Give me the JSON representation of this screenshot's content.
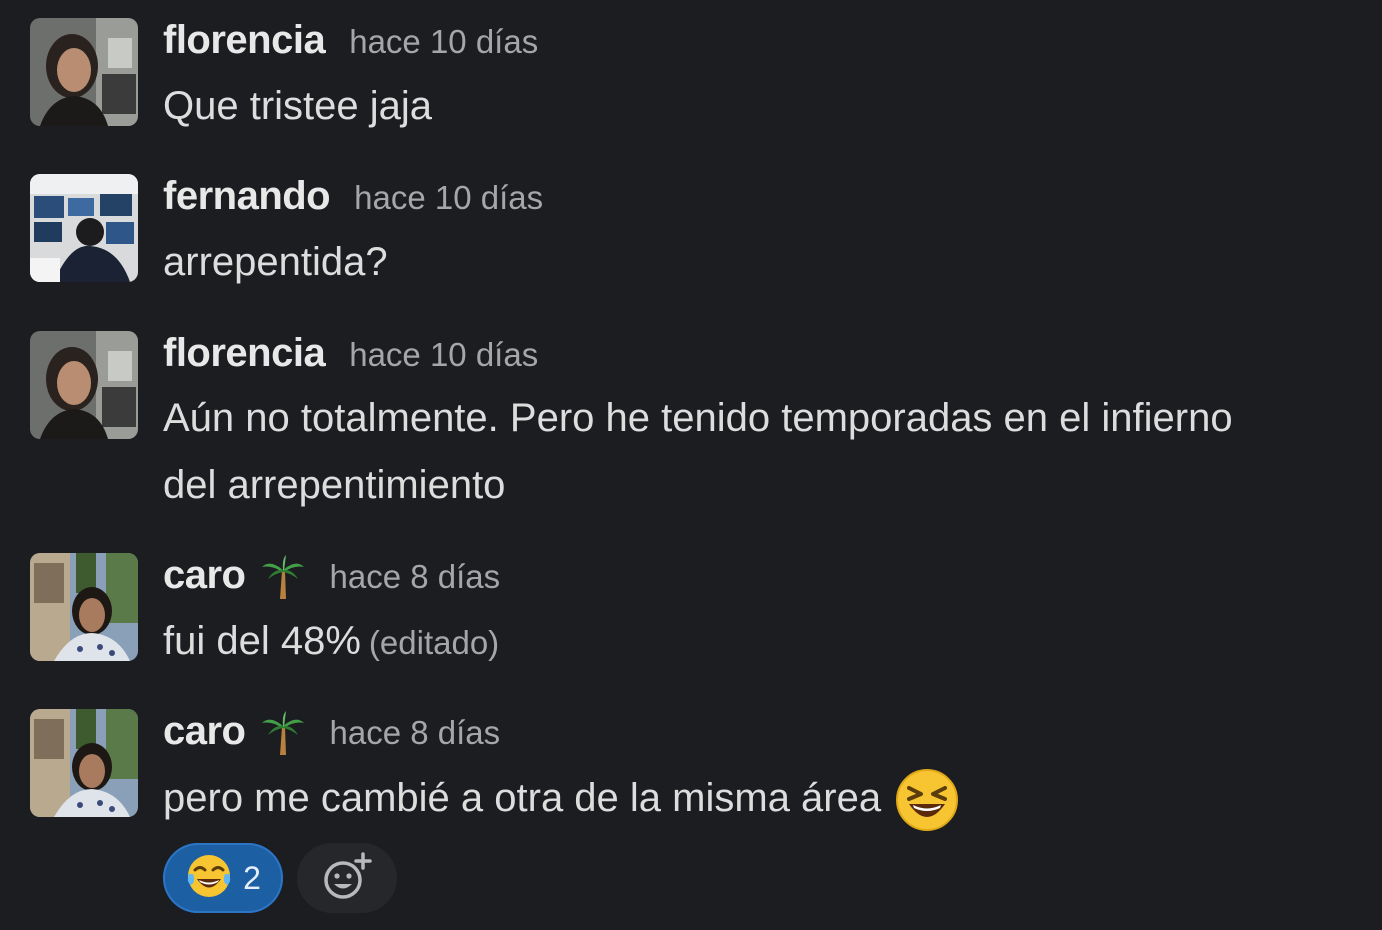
{
  "messages": [
    {
      "author": "florencia",
      "avatar": "avatar-florencia",
      "timestamp": "hace 10 días",
      "lines": [
        "Que tristee jaja"
      ]
    },
    {
      "author": "fernando",
      "avatar": "avatar-fernando",
      "timestamp": "hace 10 días",
      "lines": [
        "arrepentida?"
      ]
    },
    {
      "author": "florencia",
      "avatar": "avatar-florencia",
      "timestamp": "hace 10 días",
      "lines": [
        "Aún no totalmente. Pero he tenido temporadas en el infierno",
        "del arrepentimiento"
      ]
    },
    {
      "author": "caro",
      "avatar": "avatar-caro",
      "status_emoji": "palm-tree-icon",
      "timestamp": "hace 8 días",
      "lines": [
        "fui del 48%"
      ],
      "edited": "(editado)"
    },
    {
      "author": "caro",
      "avatar": "avatar-caro",
      "status_emoji": "palm-tree-icon",
      "timestamp": "hace 8 días",
      "lines": [
        "pero me cambié a otra de la misma área"
      ],
      "trailing_emoji": "laughing-face-icon",
      "reactions": [
        {
          "emoji": "tears-of-joy-icon",
          "count": "2",
          "selected": true
        }
      ],
      "add_reaction_icon": "add-reaction-icon"
    }
  ],
  "colors": {
    "background": "#1b1d21",
    "author": "#e8e8e8",
    "timestamp": "#a5a6a8",
    "reaction_selected_bg": "#1d5fa3"
  }
}
